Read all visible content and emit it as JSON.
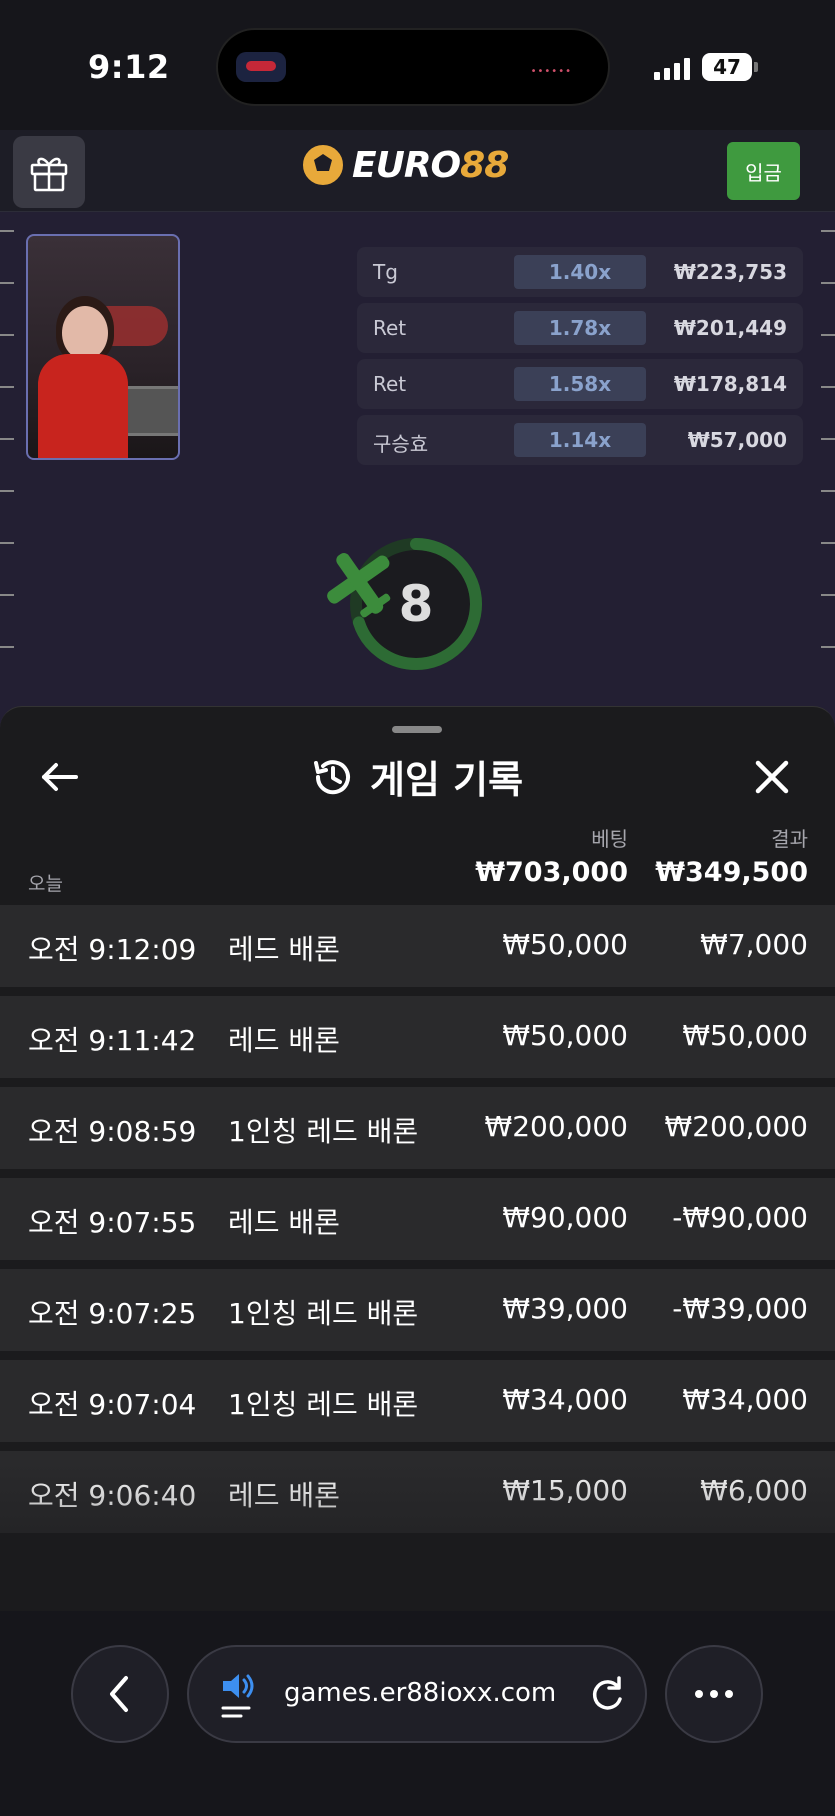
{
  "status_bar": {
    "time": "9:12",
    "battery": "47"
  },
  "header": {
    "logo_a": "EURO",
    "logo_b": "88",
    "deposit_label": "입금"
  },
  "game": {
    "bets": [
      {
        "name": "Tg",
        "multiplier": "1.40x",
        "amount": "₩223,753"
      },
      {
        "name": "Ret",
        "multiplier": "1.78x",
        "amount": "₩201,449"
      },
      {
        "name": "Ret",
        "multiplier": "1.58x",
        "amount": "₩178,814"
      },
      {
        "name": "구승효",
        "multiplier": "1.14x",
        "amount": "₩57,000"
      }
    ],
    "countdown": "8",
    "countdown_fraction": 0.7
  },
  "history": {
    "title": "게임 기록",
    "col_bet": "베팅",
    "col_result": "결과",
    "today_label": "오늘",
    "total_bet": "₩703,000",
    "total_result": "₩349,500",
    "rows": [
      {
        "time": "오전 9:12:09",
        "game": "레드 배론",
        "bet": "₩50,000",
        "result": "₩7,000"
      },
      {
        "time": "오전 9:11:42",
        "game": "레드 배론",
        "bet": "₩50,000",
        "result": "₩50,000"
      },
      {
        "time": "오전 9:08:59",
        "game": "1인칭 레드 배론",
        "bet": "₩200,000",
        "result": "₩200,000"
      },
      {
        "time": "오전 9:07:55",
        "game": "레드 배론",
        "bet": "₩90,000",
        "result": "-₩90,000"
      },
      {
        "time": "오전 9:07:25",
        "game": "1인칭 레드 배론",
        "bet": "₩39,000",
        "result": "-₩39,000"
      },
      {
        "time": "오전 9:07:04",
        "game": "1인칭 레드 배론",
        "bet": "₩34,000",
        "result": "₩34,000"
      },
      {
        "time": "오전 9:06:40",
        "game": "레드 배론",
        "bet": "₩15,000",
        "result": "₩6,000"
      }
    ]
  },
  "browser": {
    "url": "games.er88ioxx.com"
  },
  "colors": {
    "accent_green": "#3f9a3f",
    "logo_gold": "#e8a93a",
    "sheet_bg": "#1b1b1d",
    "row_bg": "#2a2a2c"
  }
}
